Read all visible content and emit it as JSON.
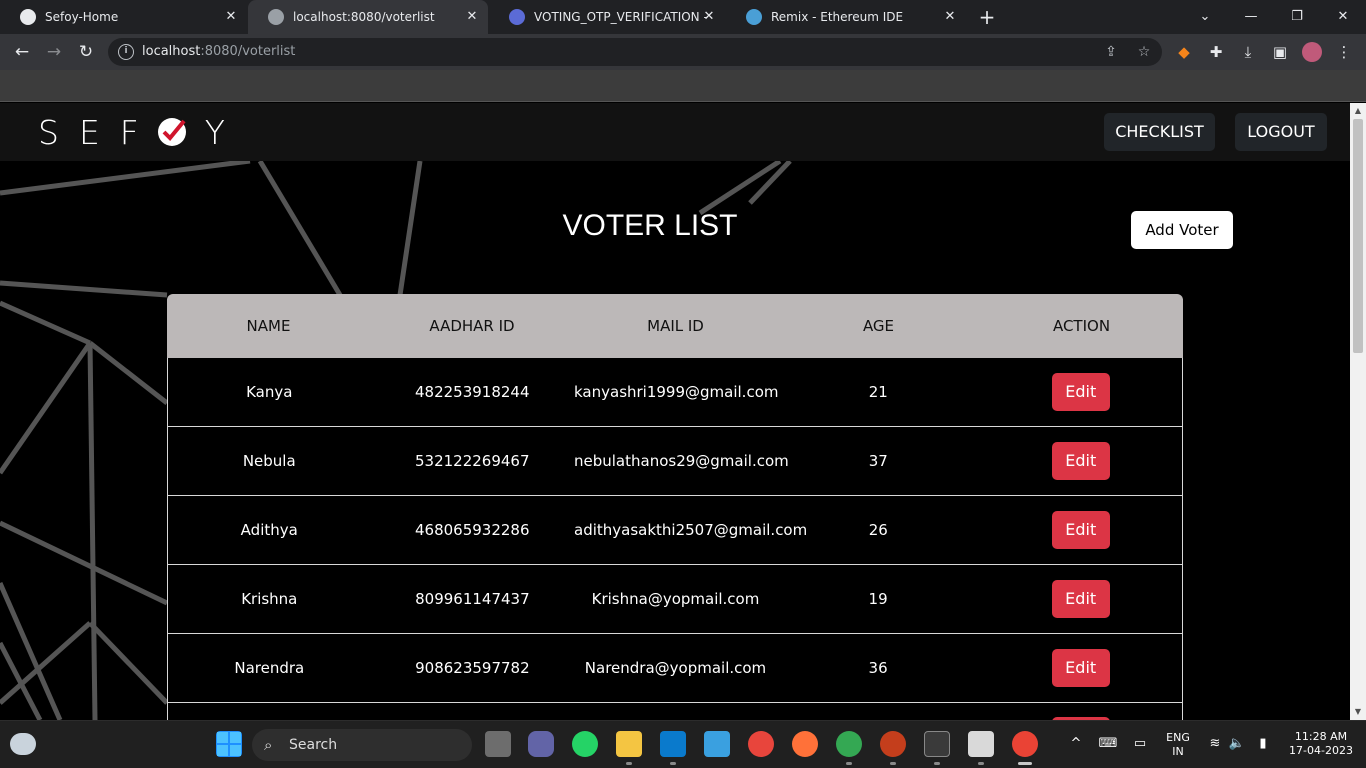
{
  "browser": {
    "tabs": [
      {
        "title": "Sefoy-Home",
        "fav_color": "#e8eaed"
      },
      {
        "title": "localhost:8080/voterlist",
        "fav_color": "#9aa0a6"
      },
      {
        "title": "VOTING_OTP_VERIFICATION - sh",
        "fav_color": "#5b6bd6"
      },
      {
        "title": "Remix - Ethereum IDE",
        "fav_color": "#4a9fd6"
      }
    ],
    "url_host": "localhost",
    "url_path": ":8080/voterlist"
  },
  "app": {
    "logo": "SEF Y",
    "logo_left": "SEF",
    "logo_right": "Y",
    "nav": {
      "checklist": "CHECKLIST",
      "logout": "LOGOUT"
    },
    "title": "VOTER LIST",
    "add_voter": "Add Voter"
  },
  "table": {
    "headers": [
      "NAME",
      "AADHAR ID",
      "MAIL ID",
      "AGE",
      "ACTION"
    ],
    "rows": [
      {
        "name": "Kanya",
        "aadhar": "482253918244",
        "mail": "kanyashri1999@gmail.com",
        "age": "21",
        "action": "Edit"
      },
      {
        "name": "Nebula",
        "aadhar": "532122269467",
        "mail": "nebulathanos29@gmail.com",
        "age": "37",
        "action": "Edit"
      },
      {
        "name": "Adithya",
        "aadhar": "468065932286",
        "mail": "adithyasakthi2507@gmail.com",
        "age": "26",
        "action": "Edit"
      },
      {
        "name": "Krishna",
        "aadhar": "809961147437",
        "mail": "Krishna@yopmail.com",
        "age": "19",
        "action": "Edit"
      },
      {
        "name": "Narendra",
        "aadhar": "908623597782",
        "mail": "Narendra@yopmail.com",
        "age": "36",
        "action": "Edit"
      }
    ]
  },
  "taskbar": {
    "search": "Search",
    "lang_1": "ENG",
    "lang_2": "IN",
    "time": "11:28 AM",
    "date": "17-04-2023"
  },
  "colors": {
    "accent_red": "#dc3545",
    "header_gray": "#bcb8b8",
    "nav_bg": "#121212"
  }
}
